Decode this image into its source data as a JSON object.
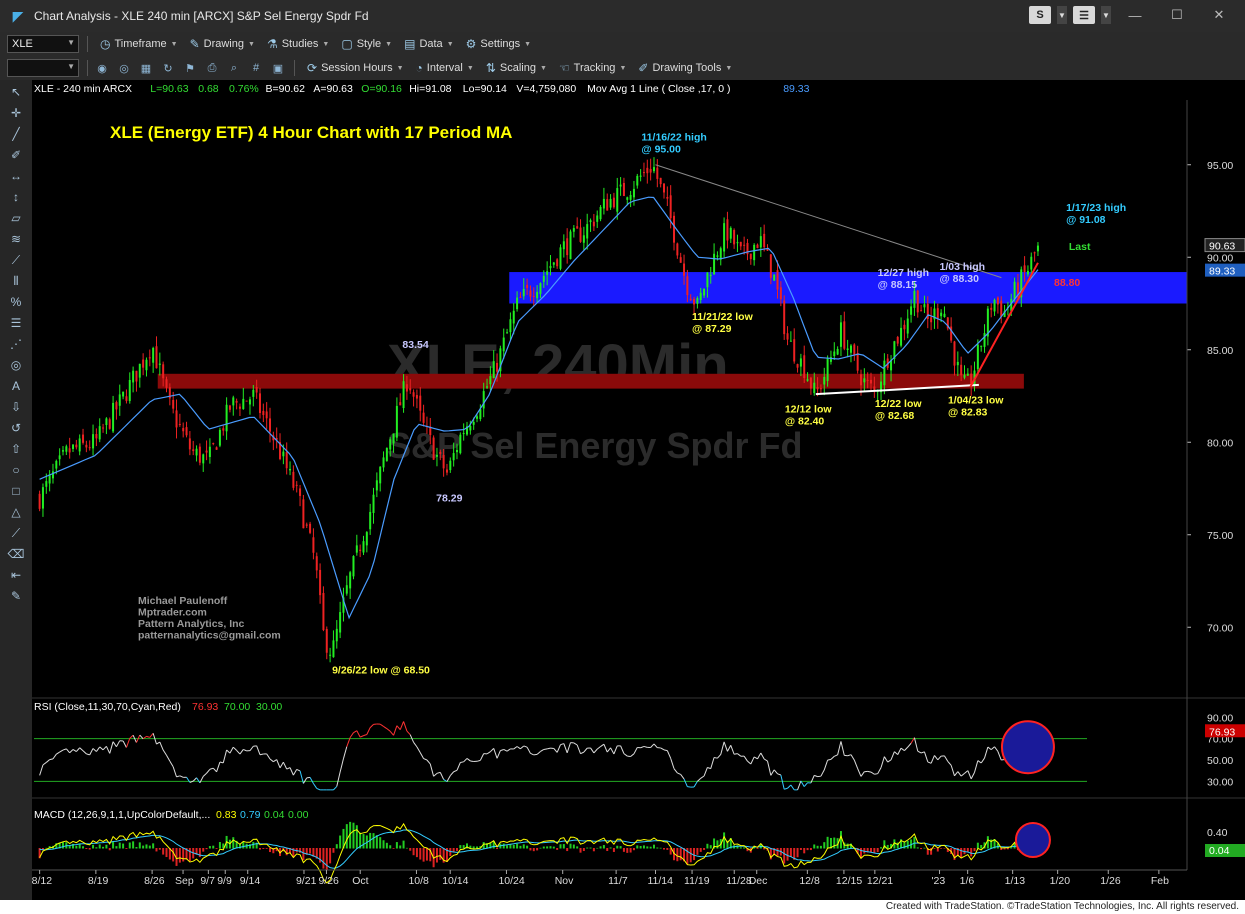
{
  "window": {
    "title": "Chart Analysis - XLE 240 min [ARCX] S&P Sel Energy Spdr Fd",
    "btn_s": "S",
    "btn_menu": "☰"
  },
  "toolbar1": {
    "symbol": "XLE",
    "menus": [
      {
        "icon": "clock-icon",
        "glyph": "◷",
        "label": "Timeframe"
      },
      {
        "icon": "pencil-icon",
        "glyph": "✎",
        "label": "Drawing"
      },
      {
        "icon": "flask-icon",
        "glyph": "⚗",
        "label": "Studies"
      },
      {
        "icon": "style-icon",
        "glyph": "▢",
        "label": "Style"
      },
      {
        "icon": "data-icon",
        "glyph": "▤",
        "label": "Data"
      },
      {
        "icon": "gear-icon",
        "glyph": "⚙",
        "label": "Settings"
      }
    ]
  },
  "toolbar2": {
    "menus": [
      {
        "icon": "session-icon",
        "glyph": "⟳",
        "label": "Session Hours"
      },
      {
        "icon": "interval-icon",
        "glyph": "◔",
        "label": "Interval"
      },
      {
        "icon": "scaling-icon",
        "glyph": "⇅",
        "label": "Scaling"
      },
      {
        "icon": "tracking-icon",
        "glyph": "☜",
        "label": "Tracking"
      },
      {
        "icon": "drawing-tools-icon",
        "glyph": "✐",
        "label": "Drawing Tools"
      }
    ]
  },
  "header_line": [
    {
      "t": "XLE - 240 min  ARCX",
      "c": "#ffffff"
    },
    {
      "t": "L=90.63",
      "c": "#33dd33"
    },
    {
      "t": "0.68",
      "c": "#33dd33"
    },
    {
      "t": "0.76%",
      "c": "#33dd33"
    },
    {
      "t": "B=90.62",
      "c": "#ffffff"
    },
    {
      "t": "A=90.63",
      "c": "#ffffff"
    },
    {
      "t": "O=90.16",
      "c": "#33dd33"
    },
    {
      "t": "Hi=91.08",
      "c": "#ffffff"
    },
    {
      "t": "Lo=90.14",
      "c": "#ffffff"
    },
    {
      "t": "V=4,759,080",
      "c": "#ffffff"
    },
    {
      "t": "Mov Avg 1 Line (  Close ,17,  0 )",
      "c": "#ffffff"
    },
    {
      "t": "89.33",
      "c": "#4a9cff"
    }
  ],
  "chart_data": [
    {
      "type": "candlestick",
      "title": "XLE (Energy ETF) 4 Hour Chart with 17 Period MA",
      "watermark": [
        "XLE, 240Min",
        "S&P Sel Energy Spdr Fd"
      ],
      "author_block": [
        "Michael Paulenoff",
        "Mptrader.com",
        "Pattern Analytics, Inc",
        "patternanalytics@gmail.com"
      ],
      "ylim": [
        66.5,
        98.5
      ],
      "yticks": [
        70.0,
        75.0,
        80.0,
        85.0,
        90.0,
        95.0
      ],
      "ytick_labels": [
        "70.00",
        "75.00",
        "80.00",
        "85.00",
        "90.00",
        "95.00"
      ],
      "x_labels": [
        "8/12",
        "8/19",
        "8/26",
        "Sep",
        "9/7",
        "9/9",
        "9/14",
        "9/21",
        "9/26",
        "Oct",
        "10/8",
        "10/14",
        "10/24",
        "Nov",
        "11/7",
        "11/14",
        "11/19",
        "11/28",
        "Dec",
        "12/8",
        "12/15",
        "12/21",
        "'23",
        "1/6",
        "1/13",
        "1/20",
        "1/26",
        "Feb"
      ],
      "x_label_pos": [
        0.0,
        1.0,
        2.0,
        2.55,
        3.0,
        3.3,
        3.7,
        4.7,
        5.1,
        5.7,
        6.7,
        7.3,
        8.3,
        9.3,
        10.25,
        10.95,
        11.6,
        12.35,
        12.75,
        13.65,
        14.3,
        14.85,
        16.0,
        16.5,
        17.3,
        18.1,
        19.0,
        19.9
      ],
      "x_range": [
        -0.1,
        20.4
      ],
      "anchors": [
        [
          0,
          77.0
        ],
        [
          0.5,
          79.5
        ],
        [
          1.0,
          80.0
        ],
        [
          1.5,
          82.5
        ],
        [
          2.0,
          85.3
        ],
        [
          2.3,
          82.0
        ],
        [
          2.7,
          79.5
        ],
        [
          3.0,
          79.0
        ],
        [
          3.4,
          82.0
        ],
        [
          3.8,
          82.5
        ],
        [
          4.2,
          80.0
        ],
        [
          4.6,
          77.0
        ],
        [
          4.9,
          73.5
        ],
        [
          5.05,
          69.5
        ],
        [
          5.2,
          68.6
        ],
        [
          5.5,
          72.5
        ],
        [
          5.9,
          76.5
        ],
        [
          6.2,
          80.0
        ],
        [
          6.55,
          83.5
        ],
        [
          6.8,
          81.0
        ],
        [
          7.05,
          79.3
        ],
        [
          7.25,
          78.3
        ],
        [
          7.5,
          80.5
        ],
        [
          7.8,
          82.0
        ],
        [
          8.1,
          84.0
        ],
        [
          8.5,
          87.5
        ],
        [
          8.9,
          88.8
        ],
        [
          9.3,
          90.5
        ],
        [
          9.7,
          91.5
        ],
        [
          10.1,
          93.0
        ],
        [
          10.5,
          93.8
        ],
        [
          10.9,
          95.0
        ],
        [
          11.2,
          92.3
        ],
        [
          11.5,
          88.6
        ],
        [
          11.7,
          87.3
        ],
        [
          11.9,
          89.3
        ],
        [
          12.2,
          91.5
        ],
        [
          12.5,
          90.0
        ],
        [
          12.8,
          91.0
        ],
        [
          13.05,
          89.0
        ],
        [
          13.3,
          85.5
        ],
        [
          13.6,
          84.0
        ],
        [
          13.8,
          82.5
        ],
        [
          14.0,
          84.0
        ],
        [
          14.25,
          86.0
        ],
        [
          14.45,
          84.5
        ],
        [
          14.65,
          83.3
        ],
        [
          14.85,
          82.7
        ],
        [
          15.1,
          84.8
        ],
        [
          15.35,
          86.2
        ],
        [
          15.55,
          88.0
        ],
        [
          15.8,
          86.5
        ],
        [
          16.05,
          87.5
        ],
        [
          16.2,
          85.5
        ],
        [
          16.4,
          83.0
        ],
        [
          16.55,
          83.2
        ],
        [
          16.75,
          85.5
        ],
        [
          16.95,
          87.8
        ],
        [
          17.15,
          87.0
        ],
        [
          17.4,
          88.5
        ],
        [
          17.6,
          89.5
        ],
        [
          17.75,
          90.63
        ]
      ],
      "ma_anchors": [
        [
          0,
          78.0
        ],
        [
          1.0,
          79.3
        ],
        [
          2.0,
          82.3
        ],
        [
          2.5,
          82.6
        ],
        [
          3.0,
          80.7
        ],
        [
          3.8,
          81.4
        ],
        [
          4.5,
          79.2
        ],
        [
          5.0,
          75.5
        ],
        [
          5.5,
          70.5
        ],
        [
          5.9,
          73.0
        ],
        [
          6.3,
          78.0
        ],
        [
          6.7,
          81.0
        ],
        [
          7.2,
          80.6
        ],
        [
          7.6,
          80.7
        ],
        [
          8.0,
          82.6
        ],
        [
          8.5,
          86.5
        ],
        [
          9.0,
          88.0
        ],
        [
          9.5,
          89.8
        ],
        [
          10.0,
          91.4
        ],
        [
          10.5,
          93.0
        ],
        [
          10.9,
          93.3
        ],
        [
          11.3,
          91.6
        ],
        [
          11.7,
          90.0
        ],
        [
          12.1,
          89.9
        ],
        [
          12.6,
          90.3
        ],
        [
          13.0,
          90.5
        ],
        [
          13.4,
          87.8
        ],
        [
          13.8,
          84.6
        ],
        [
          14.2,
          84.5
        ],
        [
          14.6,
          84.8
        ],
        [
          15.0,
          84.0
        ],
        [
          15.4,
          85.2
        ],
        [
          15.8,
          86.9
        ],
        [
          16.1,
          86.5
        ],
        [
          16.5,
          84.8
        ],
        [
          16.9,
          86.0
        ],
        [
          17.3,
          87.6
        ],
        [
          17.75,
          89.33
        ]
      ],
      "last_price": 90.63,
      "last_label": "90.63",
      "ma_last": 89.33,
      "ma_label": "89.33",
      "zones": [
        {
          "name": "blue-support-zone",
          "x0": 8.35,
          "x1": 20.4,
          "y0": 87.5,
          "y1": 89.2,
          "color": "#1a1aff"
        },
        {
          "name": "red-support-zone",
          "x0": 2.1,
          "x1": 17.5,
          "y0": 82.9,
          "y1": 83.7,
          "color": "#8b0a0a"
        }
      ],
      "lines": [
        {
          "name": "downtrend-line",
          "x0": 10.95,
          "y0": 95.0,
          "x1": 17.1,
          "y1": 88.9,
          "color": "#888888",
          "w": 1
        },
        {
          "name": "support-line",
          "x0": 13.8,
          "y0": 82.6,
          "x1": 16.7,
          "y1": 83.1,
          "color": "#ffffff",
          "w": 2
        },
        {
          "name": "uptrend-line",
          "x0": 16.55,
          "y0": 83.0,
          "x1": 17.75,
          "y1": 89.7,
          "color": "#ff2222",
          "w": 2
        }
      ],
      "annotations": [
        {
          "t": [
            "11/16/22 high",
            "@ 95.00"
          ],
          "x": 10.7,
          "y": 96.3,
          "c": "#33ccff"
        },
        {
          "t": [
            "1/17/23 high",
            "@ 91.08"
          ],
          "x": 18.25,
          "y": 92.5,
          "c": "#33ccff"
        },
        {
          "t": [
            "Last"
          ],
          "x": 18.3,
          "y": 90.4,
          "c": "#33dd33"
        },
        {
          "t": [
            "12/27 high",
            "@ 88.15"
          ],
          "x": 14.9,
          "y": 89.0,
          "c": "#c8c8ff"
        },
        {
          "t": [
            "1/03 high",
            "@ 88.30"
          ],
          "x": 16.0,
          "y": 89.3,
          "c": "#c8c8ff"
        },
        {
          "t": [
            "83.54"
          ],
          "x": 6.45,
          "y": 85.1,
          "c": "#c8c8ff"
        },
        {
          "t": [
            "78.29"
          ],
          "x": 7.05,
          "y": 76.8,
          "c": "#c8c8ff"
        },
        {
          "t": [
            "11/21/22 low",
            "@ 87.29"
          ],
          "x": 11.6,
          "y": 86.6,
          "c": "#ffff44"
        },
        {
          "t": [
            "12/12 low",
            "@ 82.40"
          ],
          "x": 13.25,
          "y": 81.6,
          "c": "#ffff44"
        },
        {
          "t": [
            "12/22 low",
            "@ 82.68"
          ],
          "x": 14.85,
          "y": 81.9,
          "c": "#ffff44"
        },
        {
          "t": [
            "1/04/23 low",
            "@ 82.83"
          ],
          "x": 16.15,
          "y": 82.1,
          "c": "#ffff44"
        },
        {
          "t": [
            "9/26/22 low @ 68.50"
          ],
          "x": 5.2,
          "y": 67.5,
          "c": "#ffff44"
        }
      ],
      "right_tag_red": "88.80"
    },
    {
      "type": "line",
      "title": "RSI (Close,11,30,70,Cyan,Red)",
      "header_values": [
        "76.93",
        "70.00",
        "30.00"
      ],
      "series": [
        {
          "name": "RSI",
          "overbought_color": "#ff3333",
          "oversold_color": "#33ccff",
          "normal_color": "#dddddd"
        }
      ],
      "levels": [
        70,
        30
      ],
      "ylim": [
        20,
        95
      ],
      "yticks": [
        30,
        50,
        70,
        90
      ],
      "ytick_labels": [
        "30.00",
        "50.00",
        "70.00",
        "90.00"
      ],
      "last_value": 76.93,
      "last_label": "76.93"
    },
    {
      "type": "bar",
      "title": "MACD (12,26,9,1,1,UpColorDefault,...",
      "header_values": [
        "0.83",
        "0.79",
        "0.04",
        "0.00"
      ],
      "series": [
        {
          "name": "MACD",
          "color": "#ffff00"
        },
        {
          "name": "Signal",
          "color": "#33ccff"
        },
        {
          "name": "Histogram",
          "color": "#22cc22"
        }
      ],
      "yticks": [
        0.4
      ],
      "ytick_labels": [
        "0.40"
      ],
      "last_value": 0.04,
      "last_label": "0.04"
    }
  ],
  "footer": "Created with TradeStation. ©TradeStation Technologies, Inc. All rights reserved."
}
